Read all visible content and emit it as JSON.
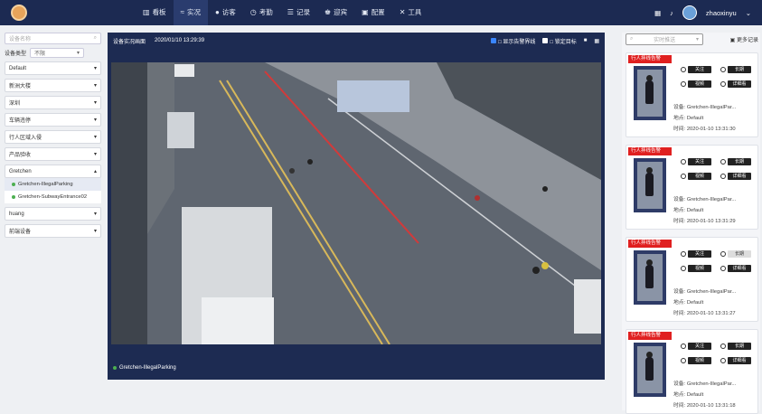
{
  "nav": {
    "items": [
      {
        "icon": "dashboard-icon",
        "label": "看板"
      },
      {
        "icon": "live-icon",
        "label": "实况"
      },
      {
        "icon": "visitor-icon",
        "label": "访客"
      },
      {
        "icon": "attendance-icon",
        "label": "考勤"
      },
      {
        "icon": "record-icon",
        "label": "记录"
      },
      {
        "icon": "welcome-icon",
        "label": "迎宾"
      },
      {
        "icon": "config-icon",
        "label": "配置"
      },
      {
        "icon": "tools-icon",
        "label": "工具"
      }
    ],
    "active": 1,
    "username": "zhaoxinyu"
  },
  "left": {
    "search_placeholder": "设备名称",
    "device_type_label": "设备类型",
    "device_type_value": "不限",
    "groups": [
      "Default",
      "新洲大楼",
      "深圳",
      "车辆违停",
      "行人区域入侵",
      "产品验收",
      "Gretchen"
    ],
    "sub_items": [
      "Gretchen-IllegalParking",
      "Gretchen-SubwayEntrance02"
    ],
    "groups_after": [
      "huang",
      "前端设备"
    ]
  },
  "video": {
    "title": "设备实况画面",
    "timestamp": "2020/01/10 13:29:39",
    "opt1": "□ 显示告警界线",
    "opt2": "□ 锁定目标",
    "footer": "Gretchen-IllegalParking"
  },
  "right": {
    "select_placeholder": "实时推送",
    "more_label": "更多记录",
    "cards": [
      {
        "tag": "行人拌线告警",
        "device": "设备: Gretchen-IllegalPar...",
        "place": "地点: Default",
        "time": "时间: 2020-01-10 13:31:30"
      },
      {
        "tag": "行人拌线告警",
        "device": "设备: Gretchen-IllegalPar...",
        "place": "地点: Default",
        "time": "时间: 2020-01-10 13:31:29"
      },
      {
        "tag": "行人拌线告警",
        "device": "设备: Gretchen-IllegalPar...",
        "place": "地点: Default",
        "time": "时间: 2020-01-10 13:31:27"
      },
      {
        "tag": "行人拌线告警",
        "device": "设备: Gretchen-IllegalPar...",
        "place": "地点: Default",
        "time": "时间: 2020-01-10 13:31:18"
      }
    ],
    "btn_labels": [
      "关注",
      "长期",
      "视频",
      "详细看"
    ]
  }
}
